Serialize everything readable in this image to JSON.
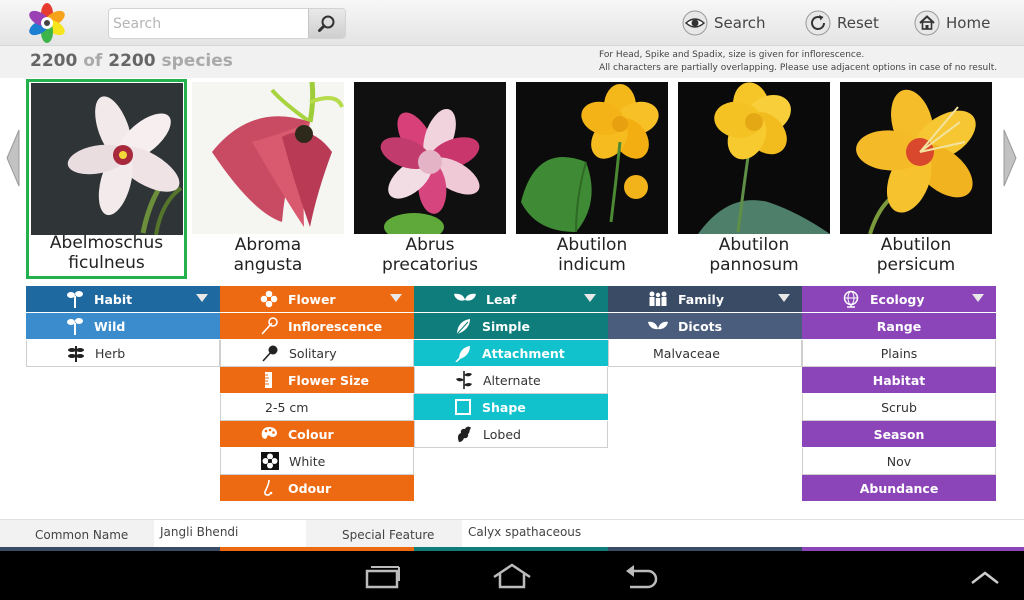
{
  "search": {
    "placeholder": "Search"
  },
  "nav": {
    "search_label": "Search",
    "reset_label": "Reset",
    "home_label": "Home"
  },
  "count": {
    "shown": "2200",
    "of": "of",
    "total": "2200",
    "unit": "species"
  },
  "notes": {
    "line1": "For Head, Spike and Spadix, size is given for inflorescence.",
    "line2": "All characters are partially overlapping. Please use adjacent options in case of no result."
  },
  "species": [
    {
      "line1": "Abelmoschus",
      "line2": "ficulneus",
      "selected": true
    },
    {
      "line1": "Abroma",
      "line2": "angusta"
    },
    {
      "line1": "Abrus",
      "line2": "precatorius"
    },
    {
      "line1": "Abutilon",
      "line2": "indicum"
    },
    {
      "line1": "Abutilon",
      "line2": "pannosum"
    },
    {
      "line1": "Abutilon",
      "line2": "persicum"
    }
  ],
  "columns": {
    "habit": {
      "header": "Habit",
      "rows": [
        "Wild",
        "Herb"
      ]
    },
    "flower": {
      "header": "Flower",
      "rows": [
        "Inflorescence",
        "Solitary",
        "Flower Size",
        "2-5 cm",
        "Colour",
        "White",
        "Odour"
      ]
    },
    "leaf": {
      "header": "Leaf",
      "rows": [
        "Simple",
        "Attachment",
        "Alternate",
        "Shape",
        "Lobed"
      ]
    },
    "family": {
      "header": "Family",
      "rows": [
        "Dicots",
        "Malvaceae"
      ]
    },
    "ecology": {
      "header": "Ecology",
      "rows": [
        "Range",
        "Plains",
        "Habitat",
        "Scrub",
        "Season",
        "Nov",
        "Abundance"
      ]
    }
  },
  "info": {
    "common_name_label": "Common Name",
    "common_name_value": "Jangli Bhendi",
    "special_feature_label": "Special Feature",
    "special_feature_value": "Calyx spathaceous"
  },
  "colors": {
    "habit_dark": "#1e6aa0",
    "habit_light": "#3b8ccc",
    "flower": "#ee6a12",
    "leaf_dark": "#0e7d7b",
    "leaf_light": "#11c2cc",
    "family_dark": "#3a4b66",
    "family_light": "#4a5d7d",
    "ecology": "#8b45b8"
  },
  "icons": [
    "logo-flower-icon",
    "magnifier-icon",
    "eye-icon",
    "reset-icon",
    "home-icon",
    "arrow-left-icon",
    "arrow-right-icon",
    "recent-apps-icon",
    "android-home-icon",
    "back-icon",
    "chevron-up-icon"
  ]
}
